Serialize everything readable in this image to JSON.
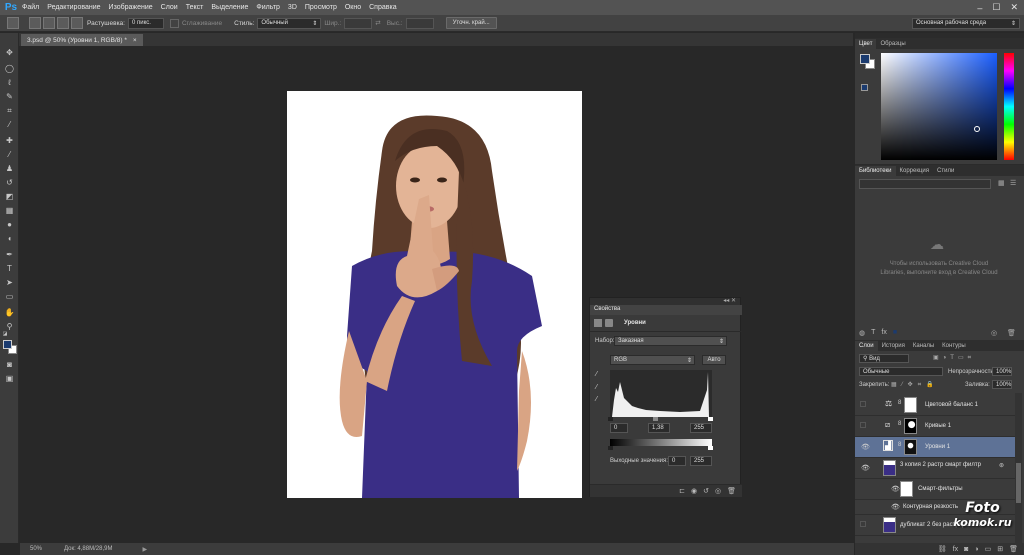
{
  "app": {
    "logo": "Ps"
  },
  "menu": [
    "Файл",
    "Редактирование",
    "Изображение",
    "Слои",
    "Текст",
    "Выделение",
    "Фильтр",
    "3D",
    "Просмотр",
    "Окно",
    "Справка"
  ],
  "window_controls": {
    "minimize": "–",
    "maximize": "☐",
    "close": "✕"
  },
  "options": {
    "feather_label": "Растушевка:",
    "feather_value": "0 пикс.",
    "antialias_label": "Сглаживание",
    "style_label": "Стиль:",
    "style_value": "Обычный",
    "width_label": "Шир.:",
    "height_label": "Выс.:",
    "refine_button": "Уточн. край...",
    "workspace": "Основная рабочая среда"
  },
  "document": {
    "tab": "3.psd @ 50% (Уровни 1, RGB/8) *"
  },
  "status": {
    "zoom": "50%",
    "doc": "Док: 4,88M/28,9M"
  },
  "properties": {
    "tab": "Свойства",
    "title": "Уровни",
    "preset_label": "Набор:",
    "preset_value": "Заказная",
    "channel": "RGB",
    "auto": "Авто",
    "input_black": "0",
    "input_gamma": "1,38",
    "input_white": "255",
    "output_label": "Выходные значения:",
    "output_black": "0",
    "output_white": "255"
  },
  "color_panel": {
    "tabs": [
      "Цвет",
      "Образцы"
    ],
    "fg": "#1b3b6f",
    "bg": "#ffffff"
  },
  "libraries": {
    "tabs": [
      "Библиотеки",
      "Коррекция",
      "Стили"
    ],
    "message": "Чтобы использовать Creative Cloud Libraries, выполните вход в Creative Cloud"
  },
  "layers_panel": {
    "tabs": [
      "Слои",
      "История",
      "Каналы",
      "Контуры"
    ],
    "filter": "Вид",
    "blend": "Обычные",
    "opacity_label": "Непрозрачность:",
    "opacity": "100%",
    "lock_label": "Закрепить:",
    "fill_label": "Заливка:",
    "fill": "100%",
    "layers": [
      {
        "name": "Цветовой баланс 1",
        "selected": false,
        "visible": false
      },
      {
        "name": "Кривые 1",
        "selected": false,
        "visible": false
      },
      {
        "name": "Уровни 1",
        "selected": true,
        "visible": true
      },
      {
        "name": "3 копия 2 растр смарт филтр",
        "selected": false,
        "visible": true
      },
      {
        "name": "Смарт-фильтры",
        "selected": false,
        "visible": true
      },
      {
        "name": "Контурная резкость",
        "selected": false,
        "visible": true
      },
      {
        "name": "дубликат 2 без растрирования",
        "selected": false,
        "visible": false
      }
    ]
  },
  "watermark": {
    "line1": "Foto",
    "line2": "komok.ru"
  }
}
